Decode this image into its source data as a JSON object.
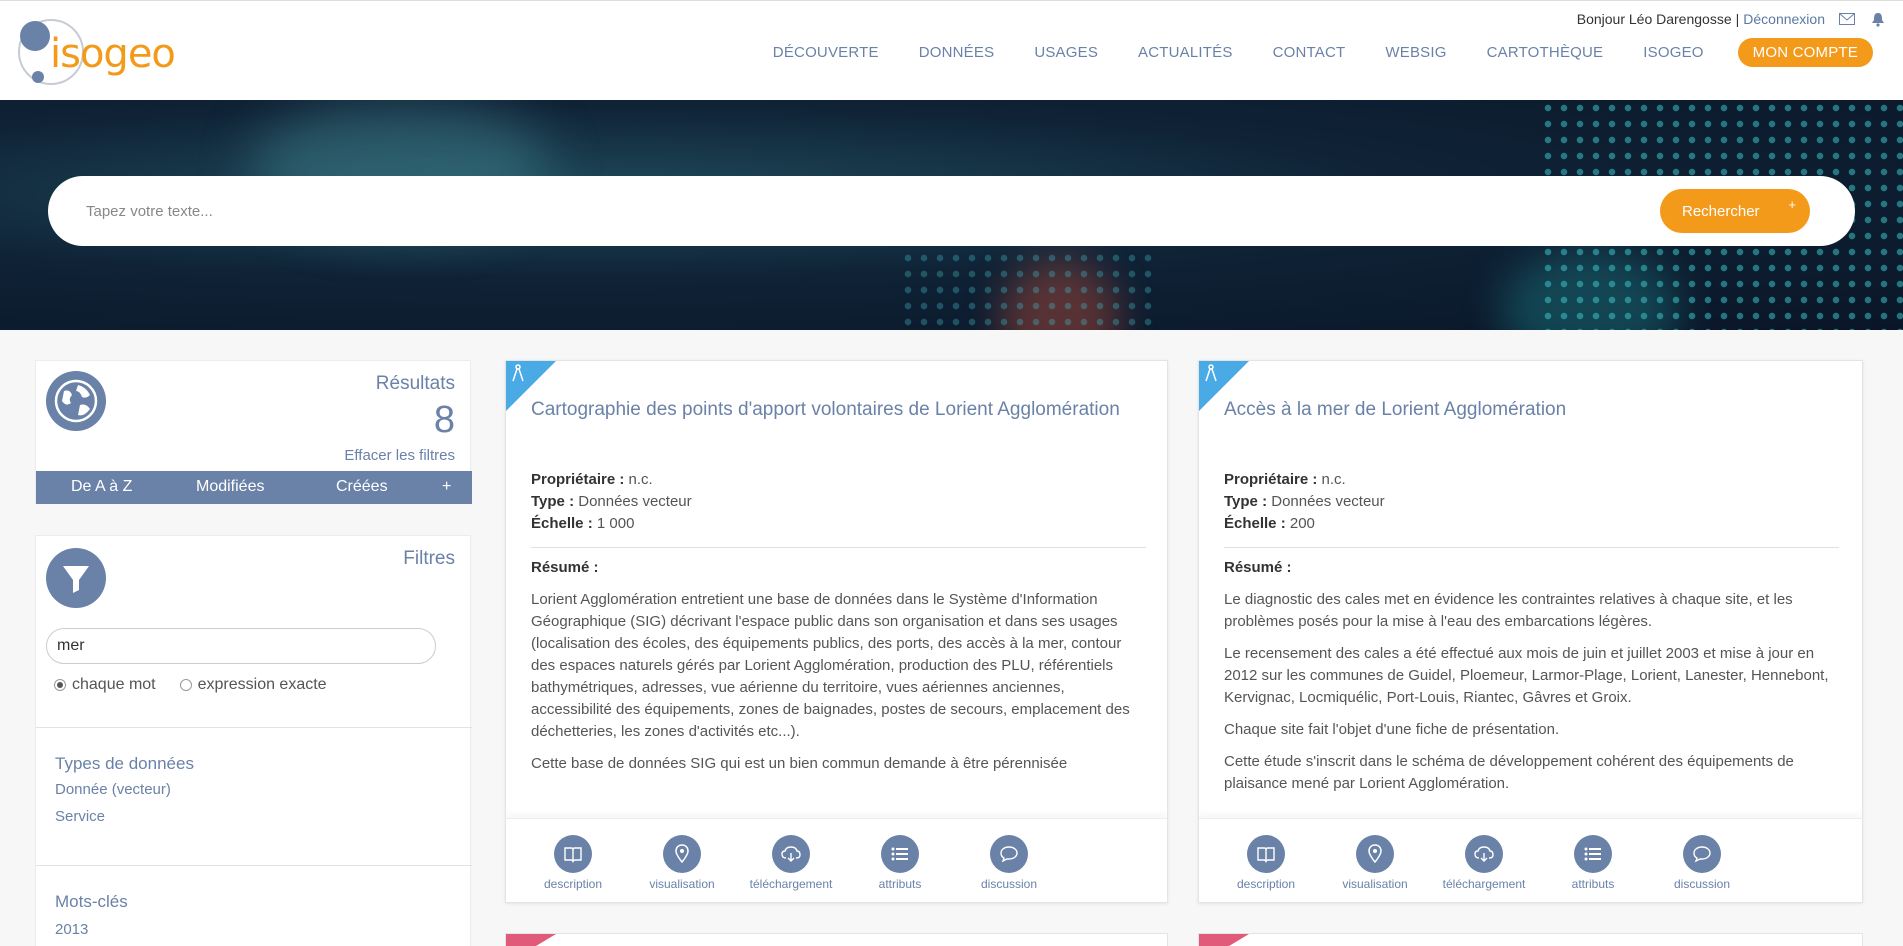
{
  "header": {
    "greeting": "Bonjour Léo Darengosse",
    "separator": "|",
    "logout": "Déconnexion",
    "logo_text": "isogeo",
    "nav": [
      "DÉCOUVERTE",
      "DONNÉES",
      "USAGES",
      "ACTUALITÉS",
      "CONTACT",
      "WEBSIG",
      "CARTOTHÈQUE",
      "ISOGEO"
    ],
    "account": "MON COMPTE"
  },
  "search": {
    "placeholder": "Tapez votre texte...",
    "button": "Rechercher",
    "button_plus": "+"
  },
  "results": {
    "title": "Résultats",
    "count": "8",
    "clear": "Effacer les filtres",
    "sort": [
      "De A à Z",
      "Modifiées",
      "Créées",
      "+"
    ]
  },
  "filters": {
    "title": "Filtres",
    "keyword": "mer",
    "radio_each": "chaque mot",
    "radio_exact": "expression exacte",
    "types_title": "Types de données",
    "types": [
      "Donnée (vecteur)",
      "Service"
    ],
    "keywords_title": "Mots-clés",
    "keywords": [
      "2013"
    ]
  },
  "cards": [
    {
      "title": "Cartographie des points d'apport volontaires de Lorient Agglomération",
      "owner_label": "Propriétaire :",
      "owner": "n.c.",
      "type_label": "Type :",
      "type": "Données vecteur",
      "scale_label": "Échelle :",
      "scale": "1 000",
      "resume_label": "Résumé :",
      "paragraphs": [
        "Lorient Agglomération entretient une base de données dans le Système d'Information Géographique (SIG) décrivant l'espace public dans son organisation et dans ses usages (localisation des écoles, des équipements publics, des ports, des accès à la mer, contour des espaces naturels gérés par Lorient Agglomération, production des PLU, référentiels bathymétriques, adresses, vue aérienne du territoire, vues aériennes anciennes, accessibilité des équipements, zones de baignades, postes de secours, emplacement des déchetteries, les zones d'activités etc...).",
        "Cette base de données SIG qui est un bien commun demande à être pérennisée"
      ]
    },
    {
      "title": "Accès à la mer de Lorient Agglomération",
      "owner_label": "Propriétaire :",
      "owner": "n.c.",
      "type_label": "Type :",
      "type": "Données vecteur",
      "scale_label": "Échelle :",
      "scale": "200",
      "resume_label": "Résumé :",
      "paragraphs": [
        "Le diagnostic des cales met en évidence les contraintes relatives à chaque site, et les problèmes posés pour la mise à l'eau des embarcations légères.",
        "Le recensement des cales a été effectué aux mois de juin et juillet 2003 et mise à jour en 2012 sur les communes de Guidel, Ploemeur, Larmor-Plage, Lorient, Lanester, Hennebont, Kervignac, Locmiquélic, Port-Louis, Riantec, Gâvres et Groix.",
        "Chaque site fait l'objet d'une fiche de présentation.",
        "Cette étude s'inscrit dans le schéma de développement cohérent des équipements de plaisance mené par Lorient Agglomération."
      ]
    }
  ],
  "actions": [
    "description",
    "visualisation",
    "téléchargement",
    "attributs",
    "discussion"
  ],
  "colors": {
    "accent": "#f39a1b",
    "primary": "#6a82a8",
    "corner_blue": "#4aaae6",
    "corner_pink": "#e05a7a"
  }
}
